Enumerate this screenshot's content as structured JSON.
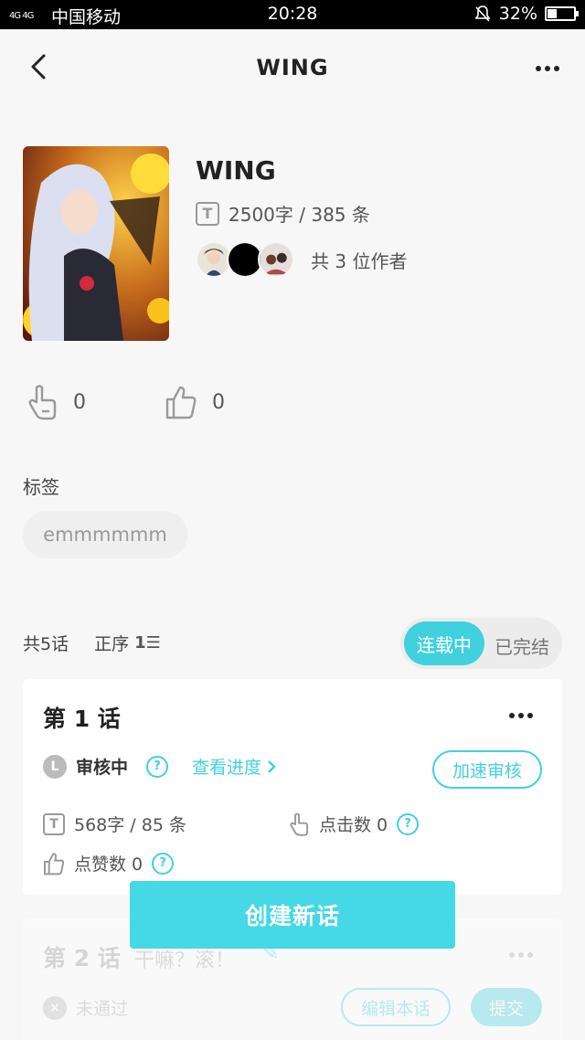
{
  "status_bar": {
    "carrier": "中国移动",
    "signal": "4G 4G",
    "time": "20:28",
    "battery": "32%",
    "battery_level": 0.32
  },
  "nav": {
    "title": "WING"
  },
  "work": {
    "title": "WING",
    "stats": "2500字 / 385 条",
    "authors_text": "共 3 位作者"
  },
  "reactions": {
    "clicks": "0",
    "likes": "0"
  },
  "tags": {
    "label": "标签",
    "items": [
      "emmmmmm"
    ]
  },
  "episodes_bar": {
    "count": "共5话",
    "order": "正序",
    "order_icon": "1☰",
    "toggle_on": "连载中",
    "toggle_off": "已完结"
  },
  "episode1": {
    "title": "第 1 话",
    "status_icon": "L",
    "status": "审核中",
    "progress_link": "查看进度",
    "speed_button": "加速审核",
    "stats": "568字 / 85 条",
    "clicks": "点击数 0",
    "likes": "点赞数 0"
  },
  "episode2": {
    "title": "第 2 话",
    "subtitle": "干嘛？滚！",
    "status": "未通过",
    "edit_button": "编辑本话",
    "submit_button": "提交"
  },
  "create_button": "创建新话",
  "colors": {
    "accent": "#41d1de",
    "background": "#f7f7f7"
  }
}
